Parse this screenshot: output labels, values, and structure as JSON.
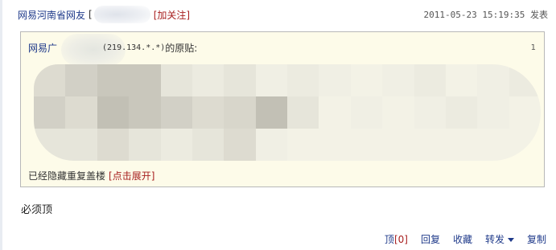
{
  "post": {
    "author": "网易河南省网友",
    "bracket_open": "[",
    "follow_label": "[加关注]",
    "timestamp": "2011-05-23 15:19:35 发表"
  },
  "quote": {
    "prefix": "网易广",
    "ip": "(219.134.*.*)",
    "suffix": "的原贴:",
    "floor": "1",
    "hidden_text": "已经隐藏重复盖楼",
    "expand_label": "[点击展开]"
  },
  "reply": {
    "text": "必须顶"
  },
  "actions": {
    "up_label": "顶",
    "up_count": "[0]",
    "reply_label": "回复",
    "favorite_label": "收藏",
    "forward_label": "转发",
    "copy_label": "复制"
  },
  "colors": {
    "link_blue": "#1f3a8a",
    "accent_red": "#a82020",
    "quote_bg": "#fdfbe9",
    "quote_border": "#b8b8b8"
  }
}
